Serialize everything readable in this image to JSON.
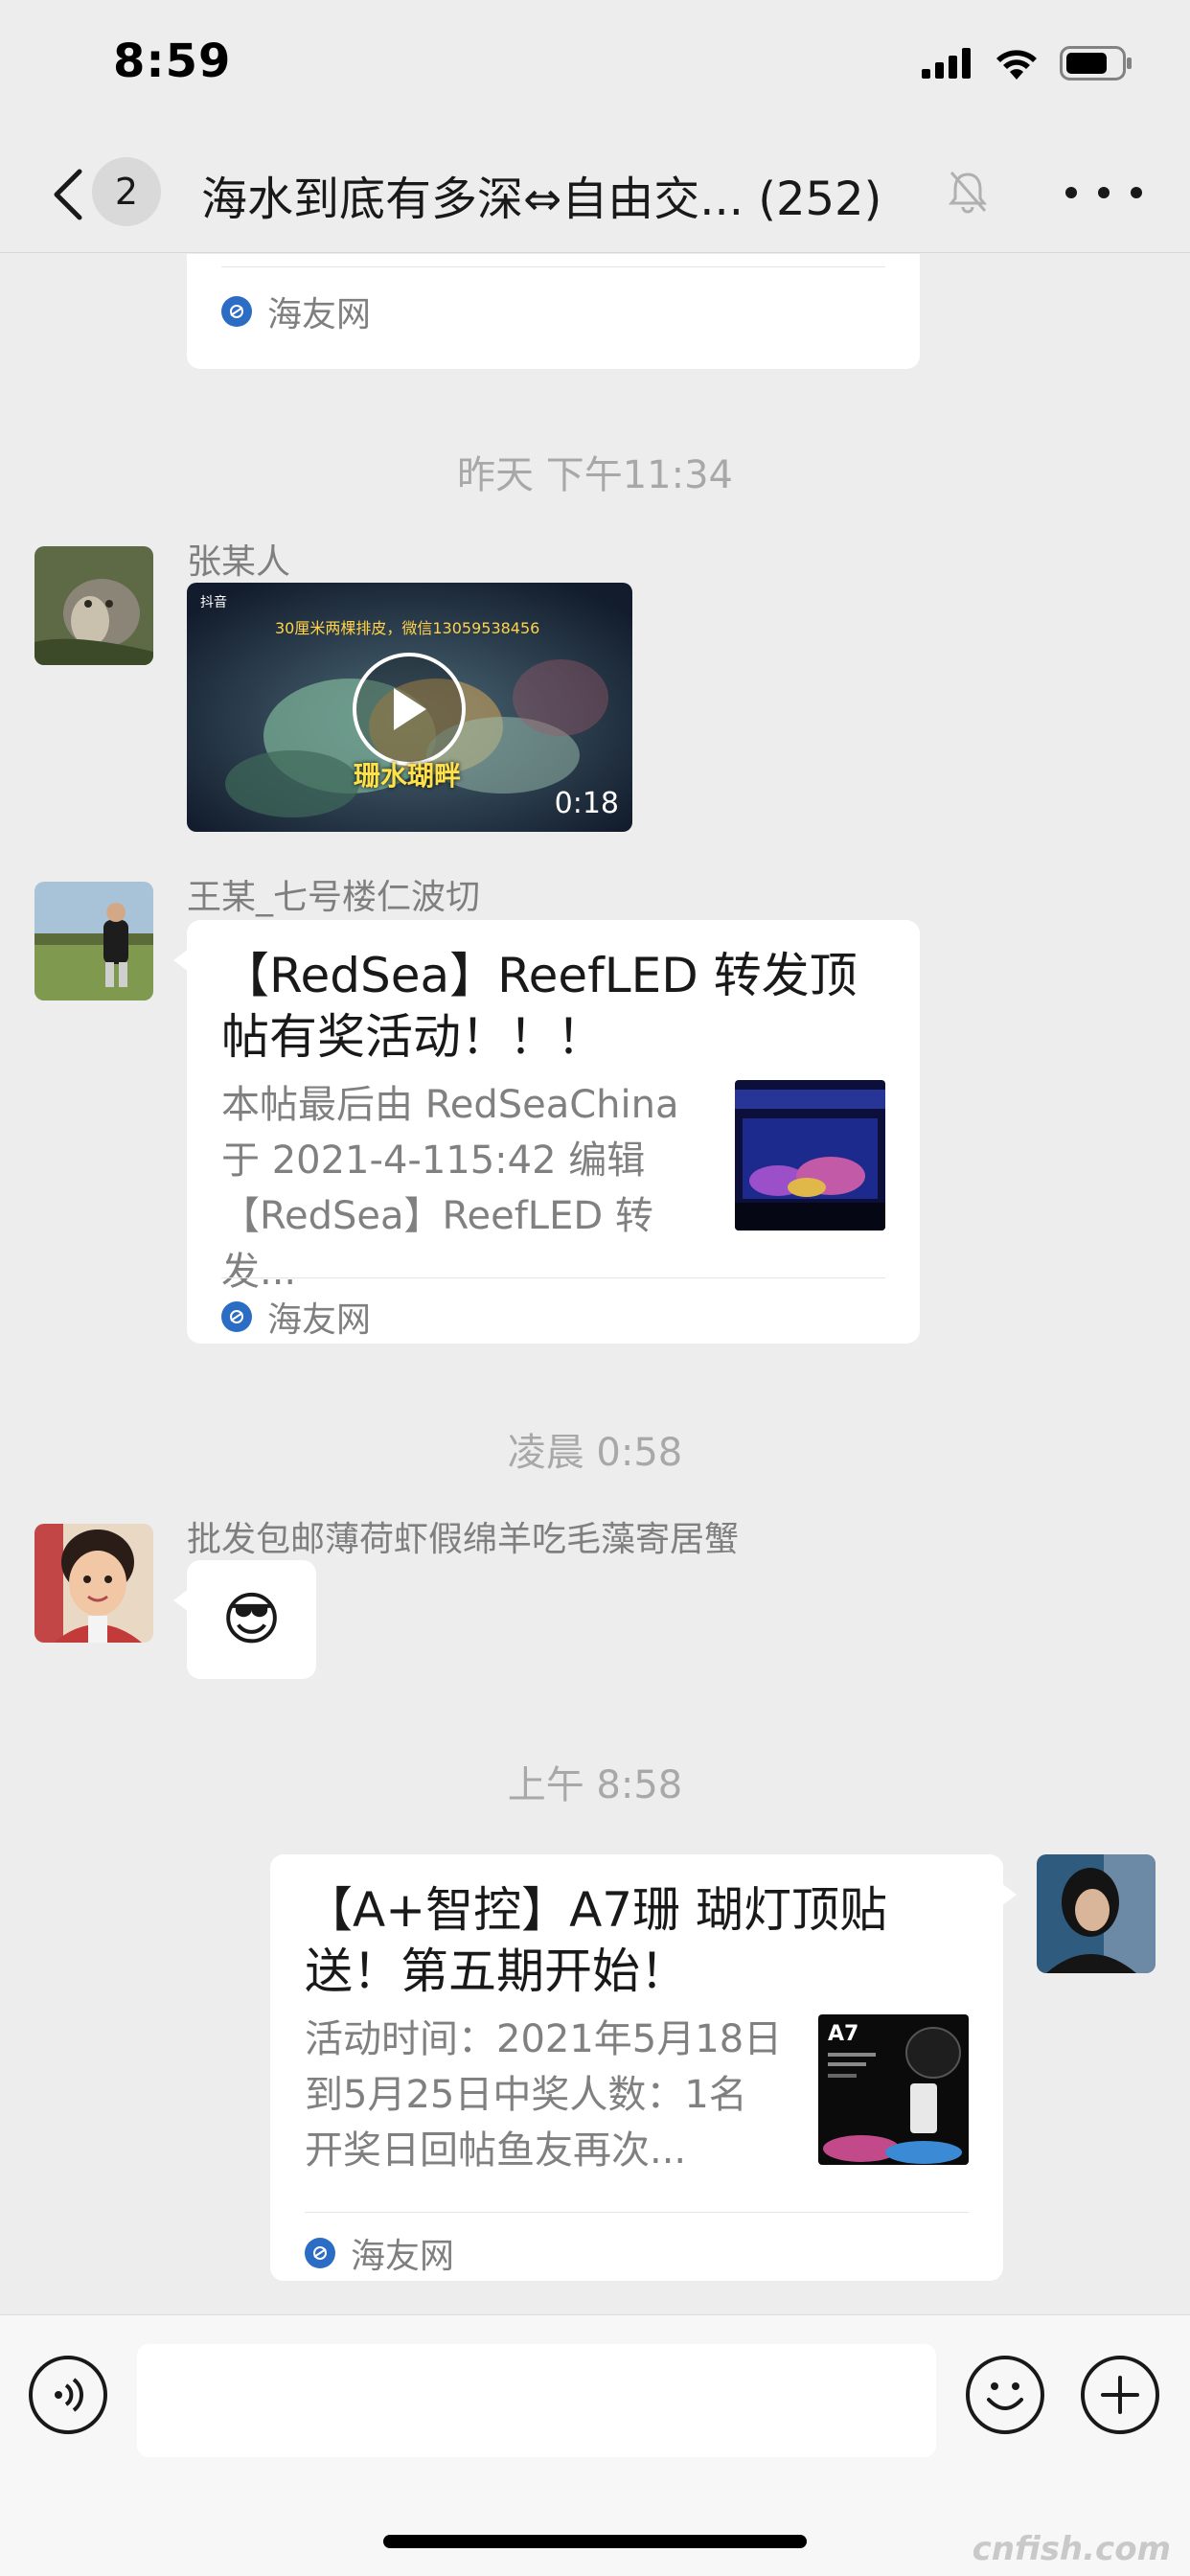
{
  "status_bar": {
    "time": "8:59"
  },
  "nav": {
    "unread_count": "2",
    "title": "海水到底有多深⇔自由交... (252)"
  },
  "messages": {
    "top_card": {
      "source": "海友网"
    },
    "time_1": "昨天 下午11:34",
    "video_msg": {
      "sender": "张某人",
      "overlay_app": "抖音",
      "overlay_caption": "30厘米两棵排皮，微信13059538456",
      "overlay_subtitle": "珊水瑚畔",
      "duration": "0:18"
    },
    "link_msg_1": {
      "sender": "王某_七号楼仁波切",
      "title": "【RedSea】ReefLED 转发顶帖有奖活动！！！",
      "description": "本帖最后由 RedSeaChina 于 2021-4-115:42 编辑【RedSea】ReefLED 转发...",
      "source": "海友网"
    },
    "time_2": "凌晨 0:58",
    "emoji_msg": {
      "sender": "批发包邮薄荷虾假绵羊吃毛藻寄居蟹",
      "emoji": "😎"
    },
    "time_3": "上午 8:58",
    "link_msg_2": {
      "title": "【A+智控】A7珊 瑚灯顶贴送！第五期开始！",
      "description": "活动时间：2021年5月18日到5月25日中奖人数：1名开奖日回帖鱼友再次...",
      "thumb_label": "A7",
      "source": "海友网"
    }
  },
  "input_bar": {
    "placeholder": ""
  },
  "watermark": "cnfish.com"
}
